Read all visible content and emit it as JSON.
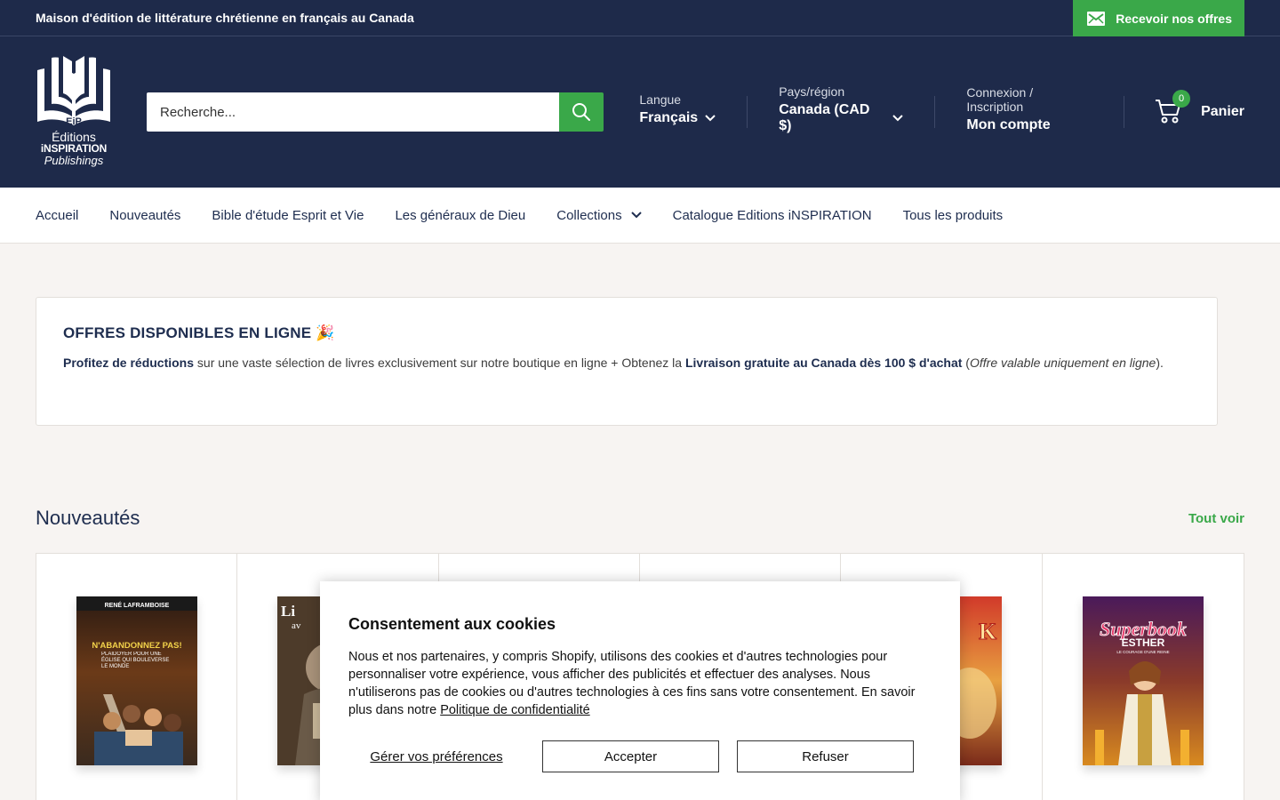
{
  "topbar": {
    "announcement": "Maison d'édition de littérature chrétienne en français au Canada",
    "offers_button": "Recevoir nos offres"
  },
  "logo": {
    "mark": "EiP",
    "line1": "Éditions",
    "line2": "iNSPIRATION",
    "line3": "Publishings"
  },
  "search": {
    "placeholder": "Recherche..."
  },
  "header": {
    "language_label": "Langue",
    "language_value": "Français",
    "country_label": "Pays/région",
    "country_value": "Canada (CAD $)",
    "account_label": "Connexion / Inscription",
    "account_value": "Mon compte",
    "cart_count": "0",
    "cart_label": "Panier"
  },
  "nav": {
    "items": [
      "Accueil",
      "Nouveautés",
      "Bible d'étude Esprit et Vie",
      "Les généraux de Dieu",
      "Collections",
      "Catalogue Editions iNSPIRATION",
      "Tous les produits"
    ]
  },
  "offer": {
    "title": "OFFRES DISPONIBLES EN LIGNE 🎉",
    "bold1": "Profitez de réductions",
    "text1": " sur une vaste sélection de livres exclusivement sur notre boutique en ligne + Obtenez la ",
    "bold2": "Livraison gratuite au Canada dès 100 $ d'achat",
    "text2": " (",
    "italic": "Offre valable uniquement en ligne",
    "text3": ")."
  },
  "section": {
    "title": "Nouveautés",
    "see_all": "Tout voir"
  },
  "products": [
    {
      "author": "RENÉ LAFRAMBOISE",
      "title": "N'ABANDONNEZ PAS!",
      "subtitle": "PLAIDOYER POUR UNE ÉGLISE QUI BOULEVERSE LE MONDE"
    },
    {
      "title_fragment": "Li",
      "title_fragment2": "av"
    },
    {},
    {},
    {
      "title_fragment": "K"
    },
    {
      "series": "Superbook",
      "title": "ESTHER",
      "subtitle": "LE COURAGE D'UNE REINE"
    }
  ],
  "cookie": {
    "title": "Consentement aux cookies",
    "text": "Nous et nos partenaires, y compris Shopify, utilisons des cookies et d'autres technologies pour personnaliser votre expérience, vous afficher des publicités et effectuer des analyses. Nous n'utiliserons pas de cookies ou d'autres technologies à ces fins sans votre consentement. En savoir plus dans notre ",
    "link": "Politique de confidentialité",
    "manage": "Gérer vos préférences",
    "accept": "Accepter",
    "refuse": "Refuser"
  },
  "colors": {
    "navy": "#1e2a4a",
    "green": "#3aa849",
    "background": "#f7f4f2"
  }
}
